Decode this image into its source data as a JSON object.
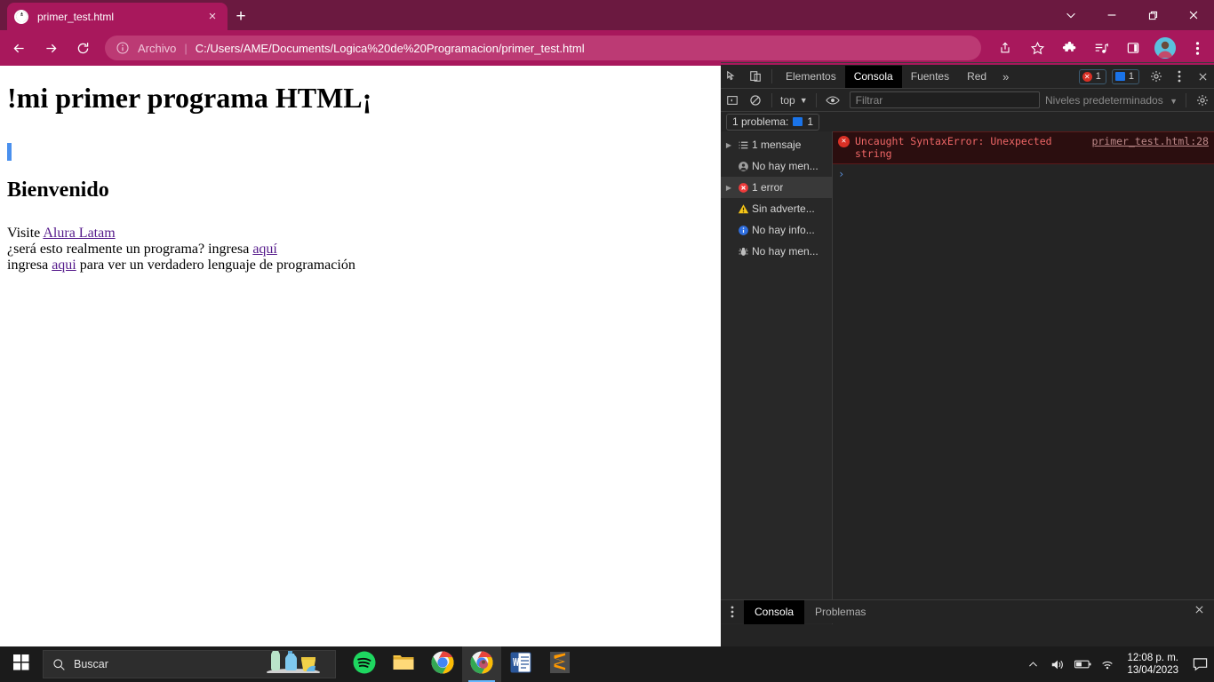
{
  "browser": {
    "tab": {
      "title": "primer_test.html",
      "favicon": "globe-icon",
      "close": "×"
    },
    "new_tab_label": "+",
    "window_controls": {
      "search_tabs": "chevron-down-icon",
      "minimize": "minimize-icon",
      "maximize": "restore-icon",
      "close": "close-icon"
    },
    "toolbar": {
      "back": "back-arrow-icon",
      "forward": "forward-arrow-icon",
      "reload": "reload-icon",
      "omnibox": {
        "scheme_label": "Archivo",
        "separator": "|",
        "url": "C:/Users/AME/Documents/Logica%20de%20Programacion/primer_test.html",
        "info_icon": "info-circle-icon"
      },
      "share": "share-icon",
      "bookmark": "star-icon",
      "extensions": "puzzle-icon",
      "media": "media-playlist-icon",
      "side_panel": "side-panel-icon",
      "profile": "profile-avatar",
      "menu": "three-dot-menu-icon"
    },
    "accent_tabstrip": "#6b1940",
    "accent_toolbar": "#a8185c"
  },
  "page": {
    "heading1": "!mi primer programa HTML¡",
    "heading2": "Bienvenido",
    "line1_prefix": "Visite ",
    "line1_link": "Alura Latam",
    "line2_prefix": "¿será esto realmente un programa? ingresa ",
    "line2_link": "aquí",
    "line3_prefix": "ingresa ",
    "line3_link": "aqui",
    "line3_suffix": " para ver un verdadero lenguaje de programación",
    "link_color": "#551a8b"
  },
  "devtools": {
    "inspect_icon": "inspect-cursor-icon",
    "device_icon": "device-toolbar-icon",
    "tabs": [
      {
        "label": "Elementos",
        "active": false
      },
      {
        "label": "Consola",
        "active": true
      },
      {
        "label": "Fuentes",
        "active": false
      },
      {
        "label": "Red",
        "active": false
      }
    ],
    "more_tabs": "»",
    "badges": {
      "errors": "1",
      "messages": "1"
    },
    "settings_icon": "gear-icon",
    "menu_icon": "three-dot-menu-icon",
    "close_icon": "close-icon",
    "console_bar": {
      "sidebar_toggle": "sidebar-toggle-icon",
      "clear_console": "clear-console-icon",
      "context": "top",
      "context_caret": "▼",
      "live_expression": "eye-icon",
      "filter_placeholder": "Filtrar",
      "levels": "Niveles predeterminados",
      "levels_caret": "▼",
      "console_settings": "gear-icon"
    },
    "problem_bar": {
      "text": "1 problema:",
      "count": "1"
    },
    "sidebar": [
      {
        "label": "1 mensaje",
        "icon": "list-icon",
        "arrow": "▶",
        "selected": false
      },
      {
        "label": "No hay men...",
        "icon": "user-circle-icon",
        "arrow": "",
        "selected": false
      },
      {
        "label": "1 error",
        "icon": "error-circle-icon",
        "arrow": "▶",
        "selected": true
      },
      {
        "label": "Sin adverte...",
        "icon": "warning-triangle-icon",
        "arrow": "",
        "selected": false
      },
      {
        "label": "No hay info...",
        "icon": "info-circle-icon",
        "arrow": "",
        "selected": false
      },
      {
        "label": "No hay men...",
        "icon": "bug-icon",
        "arrow": "",
        "selected": false
      }
    ],
    "message": {
      "icon": "error-circle-icon",
      "text": "Uncaught SyntaxError: Unexpected string",
      "source": "primer_test.html:28"
    },
    "prompt_caret": "›",
    "drawer": {
      "menu_icon": "three-dot-menu-icon",
      "tabs": [
        {
          "label": "Consola",
          "active": true
        },
        {
          "label": "Problemas",
          "active": false
        }
      ],
      "close": "close-icon"
    }
  },
  "taskbar": {
    "start": "windows-logo-icon",
    "search": {
      "icon": "search-icon",
      "placeholder": "Buscar"
    },
    "apps": [
      {
        "name": "spotify-icon",
        "active": false
      },
      {
        "name": "file-explorer-icon",
        "active": false
      },
      {
        "name": "chrome-icon",
        "active": false
      },
      {
        "name": "chrome-active-icon",
        "active": true
      },
      {
        "name": "word-icon",
        "active": false
      },
      {
        "name": "sublime-text-icon",
        "active": false
      }
    ],
    "tray": {
      "overflow": "chevron-up-icon",
      "volume": "volume-icon",
      "battery": "battery-icon",
      "network": "wifi-icon",
      "time": "12:08 p. m.",
      "date": "13/04/2023",
      "notifications": "notification-icon"
    }
  }
}
